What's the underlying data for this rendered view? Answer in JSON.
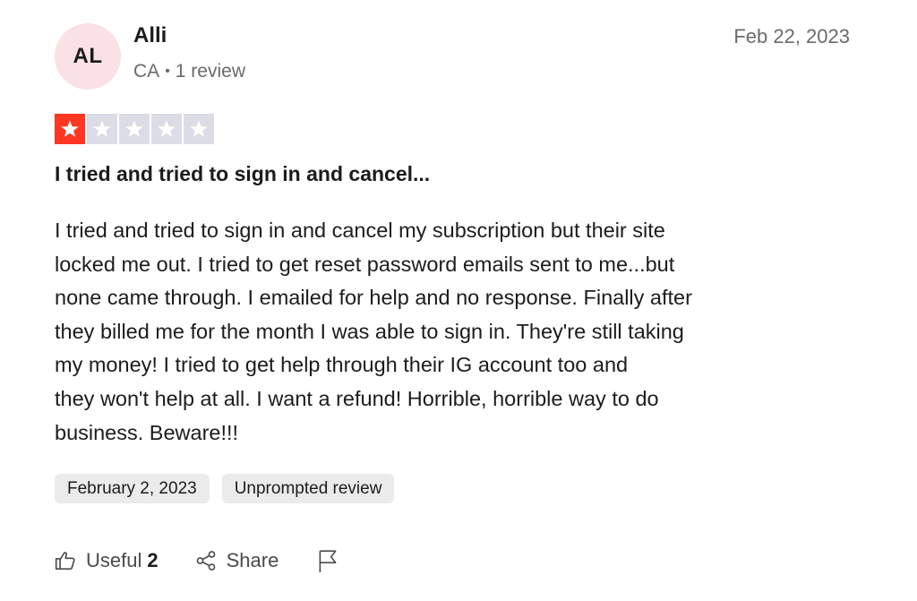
{
  "reviewer": {
    "initials": "AL",
    "name": "Alli",
    "country": "CA",
    "separator": "•",
    "review_count": "1 review"
  },
  "review": {
    "date": "Feb 22, 2023",
    "rating": 1,
    "rating_max": 5,
    "title": "I tried and tried to sign in and cancel...",
    "body_lines": [
      "I tried and tried to sign in and cancel my subscription but their site",
      "locked me out. I tried to get reset password emails sent to me...but",
      "none came through. I emailed for help and no response. Finally after",
      "they billed me for the month I was able to sign in. They're still taking",
      "my money! I tried to get help through their IG account too and",
      "they won't help at all. I want a refund! Horrible, horrible way to do",
      "business. Beware!!!"
    ]
  },
  "tags": {
    "experience_date": "February 2, 2023",
    "review_type": "Unprompted review"
  },
  "actions": {
    "useful_label": "Useful",
    "useful_count": "2",
    "share_label": "Share"
  },
  "icons": {
    "star": "star-icon",
    "useful": "thumbs-up-icon",
    "share": "share-icon",
    "report": "flag-icon"
  },
  "colors": {
    "star_on": "#ff3722",
    "star_off": "#dcdce6",
    "avatar_bg": "#f9e1e6",
    "tag_bg": "#ebebeb"
  }
}
